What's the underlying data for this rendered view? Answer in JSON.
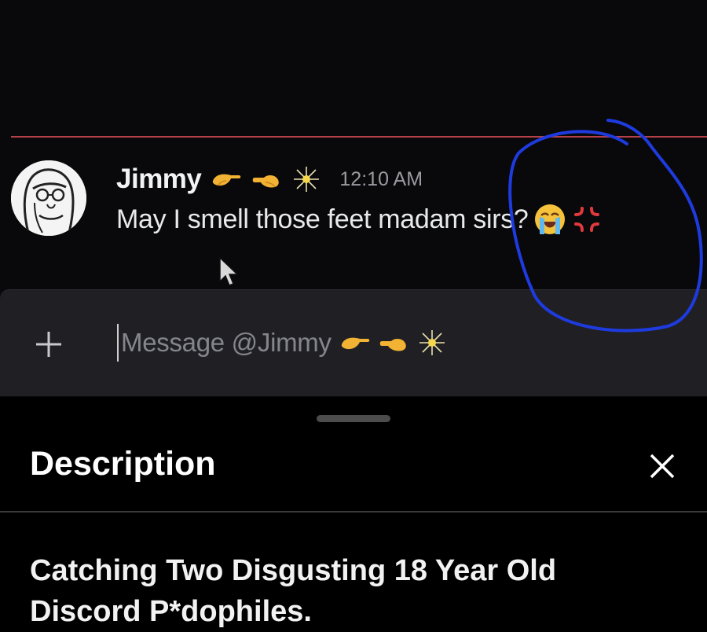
{
  "chat": {
    "message": {
      "username": "Jimmy",
      "timestamp": "12:10 AM",
      "text": "May I smell those feet madam sirs?",
      "username_emojis": [
        "pointing-right-hand-icon",
        "pointing-right-hand-icon",
        "sparkler-icon"
      ],
      "text_emojis": [
        "loudly-crying-face-icon",
        "anger-symbol-icon"
      ]
    },
    "composer": {
      "placeholder": "Message @Jimmy",
      "placeholder_emojis": [
        "pointing-right-hand-icon",
        "pointing-right-hand-icon",
        "sparkler-icon"
      ]
    },
    "colors": {
      "background": "#09090b",
      "new_messages_divider": "#b4404a",
      "annotation_scribble": "#1e3be0",
      "composer_background": "#202024"
    }
  },
  "sheet": {
    "title": "Description",
    "description": "Catching Two Disgusting 18 Year Old Discord P*dophiles."
  }
}
